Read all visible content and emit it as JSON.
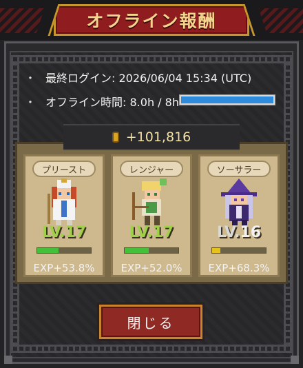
{
  "dialog": {
    "title": "オフライン報酬",
    "last_login_label": "最終ログイン: 2026/06/04 15:34 (UTC)",
    "offline_time_label": "オフライン時間: 8.0h / 8h",
    "offline_progress": 1.0,
    "gold_reward": "+101,816",
    "close_label": "閉じる"
  },
  "bullet": "・",
  "characters": [
    {
      "name": "プリースト",
      "level_prefix": "LV.",
      "level": "17",
      "exp_text": "EXP+53.8%",
      "exp_progress": 0.4,
      "exp_color": "#44c13a"
    },
    {
      "name": "レンジャー",
      "level_prefix": "LV.",
      "level": "17",
      "exp_text": "EXP+52.0%",
      "exp_progress": 0.45,
      "exp_color": "#44c13a"
    },
    {
      "name": "ソーサラー",
      "level_prefix": "LV.",
      "level": "16",
      "exp_text": "EXP+68.3%",
      "exp_progress": 0.15,
      "exp_color": "#e6c21d"
    }
  ],
  "colors": {
    "level_green": "#9ed048",
    "level_white": "#f2f2f2",
    "progress_blue": "#2f8cdc",
    "banner_red": "#8f1d1f",
    "gold_trim": "#c8962a"
  },
  "icons": {
    "gold": "gold-coin-icon",
    "priest": "priest-sprite-icon",
    "ranger": "ranger-sprite-icon",
    "sorcerer": "sorcerer-sprite-icon"
  }
}
